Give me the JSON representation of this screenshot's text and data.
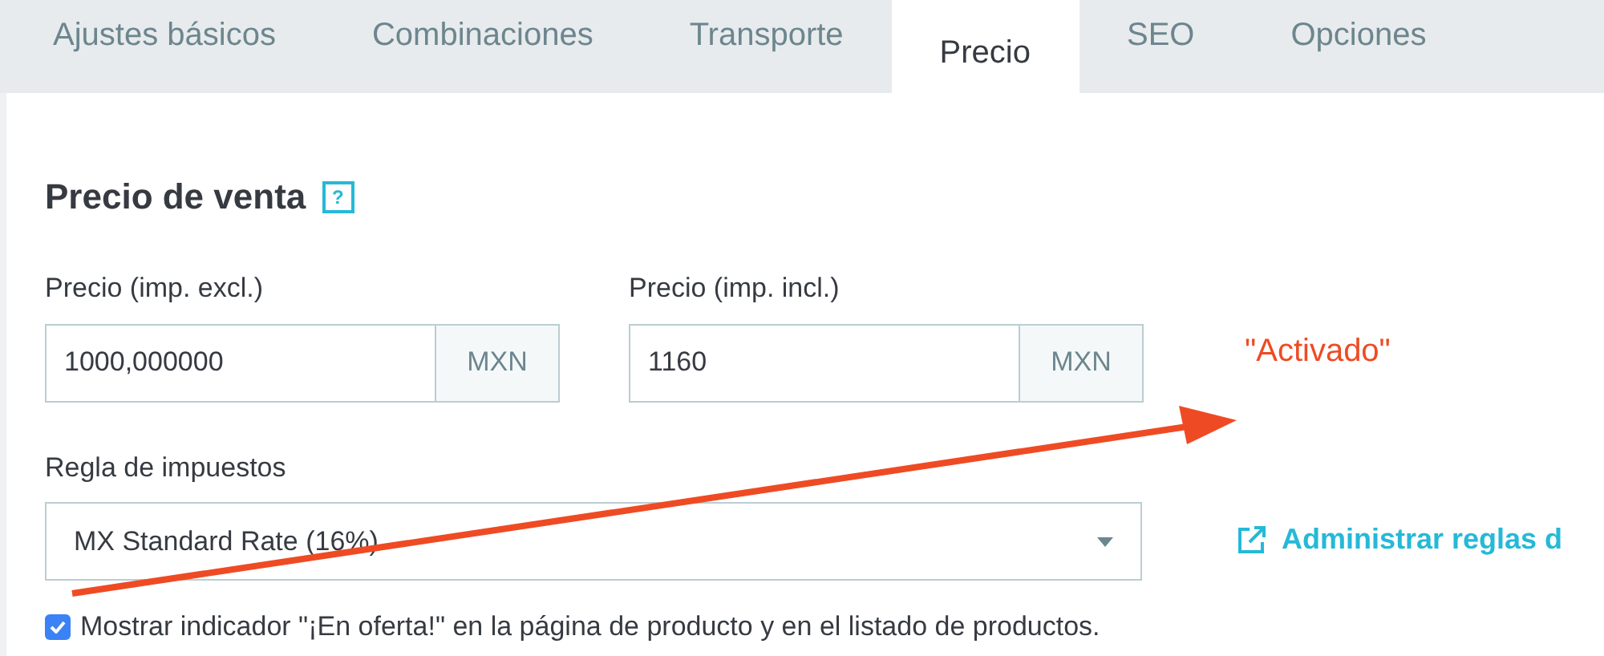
{
  "tabs": [
    {
      "label": "Ajustes básicos",
      "selected": false
    },
    {
      "label": "Combinaciones",
      "selected": false
    },
    {
      "label": "Transporte",
      "selected": false
    },
    {
      "label": "Precio",
      "selected": true
    },
    {
      "label": "SEO",
      "selected": false
    },
    {
      "label": "Opciones",
      "selected": false
    }
  ],
  "section": {
    "title": "Precio de venta",
    "help_icon": "?"
  },
  "price_fields": [
    {
      "label": "Precio (imp. excl.)",
      "value": "1000,000000",
      "currency": "MXN"
    },
    {
      "label": "Precio (imp. incl.)",
      "value": "1160",
      "currency": "MXN"
    }
  ],
  "tax_rule": {
    "label": "Regla de impuestos",
    "value": "MX Standard Rate (16%)"
  },
  "manage_link": "Administrar reglas d",
  "on_sale_checkbox": {
    "label": "Mostrar indicador \"¡En oferta!\" en la página de producto y en el listado de productos.",
    "checked": true
  },
  "annotation": {
    "text": "\"Activado\""
  }
}
